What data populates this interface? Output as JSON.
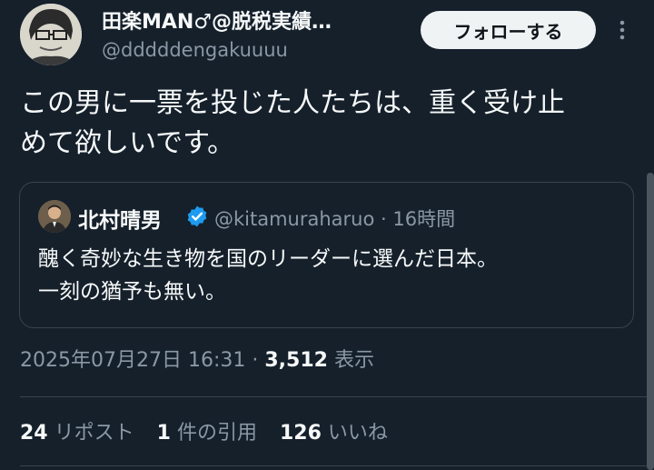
{
  "header": {
    "display_name": "田楽MAN♂@脱税実績…",
    "handle": "@dddddengakuuuu",
    "follow_label": "フォローする",
    "more_icon": "more-vertical-icon"
  },
  "tweet": {
    "text_line1": "この男に一票を投じた人たちは、重く受け止",
    "text_line2": "めて欲しいです。"
  },
  "quote": {
    "name": "北村晴男",
    "handle": "@kitamuraharuo",
    "separator": "·",
    "time": "16時間",
    "text_line1": "醜く奇妙な生き物を国のリーダーに選んだ日本。",
    "text_line2": "一刻の猶予も無い。",
    "verified_color": "#1d9bf0"
  },
  "meta": {
    "timestamp": "2025年07月27日 16:31",
    "separator": "·",
    "views": "3,512",
    "views_label": "表示"
  },
  "stats": {
    "reposts": "24",
    "reposts_label": "リポスト",
    "quotes": "1",
    "quotes_label": "件の引用",
    "likes": "126",
    "likes_label": "いいね"
  },
  "colors": {
    "background": "#15202b",
    "text": "#f7f9f9",
    "secondary": "#8b98a5",
    "border": "#38444d"
  }
}
